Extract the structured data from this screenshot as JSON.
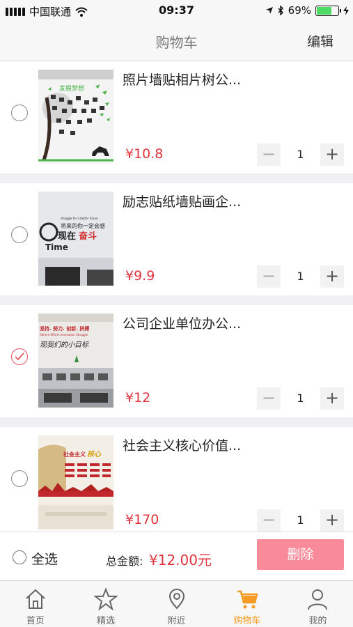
{
  "status_bar": {
    "carrier": "中国联通",
    "time": "09:37",
    "battery": "69%",
    "battery_level": 0.69
  },
  "nav": {
    "title": "购物车",
    "edit": "编辑"
  },
  "items": [
    {
      "title": "照片墙贴相片树公...",
      "price": "¥10.8",
      "qty": "1",
      "checked": false
    },
    {
      "title": "励志贴纸墙贴画企...",
      "price": "¥9.9",
      "qty": "1",
      "checked": false
    },
    {
      "title": "公司企业单位办公...",
      "price": "¥12",
      "qty": "1",
      "checked": true
    },
    {
      "title": "社会主义核心价值...",
      "price": "¥170",
      "qty": "1",
      "checked": false
    }
  ],
  "thumb_text": {
    "item1": "发展梦想",
    "item2_small": "struggle for a better future",
    "item2_cn": "将来的你一定会感",
    "item2_now": "现在",
    "item2_fight": "奋斗",
    "item2_time": "Time",
    "item3_top": "坚持. 努力. 创新. 拼搏",
    "item3_sub": "Adhere  Efforts  Innovation  Struggle",
    "item3_main": "现我们的小目标",
    "item4_title": "社会主义",
    "item4_accent": "核心"
  },
  "summary": {
    "select_all": "全选",
    "total_label": "总金额:",
    "total_amount": "¥12.00元",
    "delete": "删除"
  },
  "tabs": [
    {
      "label": "首页",
      "icon": "home-icon",
      "active": false
    },
    {
      "label": "精选",
      "icon": "star-icon",
      "active": false
    },
    {
      "label": "附近",
      "icon": "location-pin-icon",
      "active": false
    },
    {
      "label": "购物车",
      "icon": "cart-icon",
      "active": true
    },
    {
      "label": "我的",
      "icon": "user-icon",
      "active": false
    }
  ],
  "colors": {
    "accent": "#f59a23",
    "price": "#e0333e",
    "delete_button": "#f98a9a",
    "checked": "#e9545f"
  }
}
